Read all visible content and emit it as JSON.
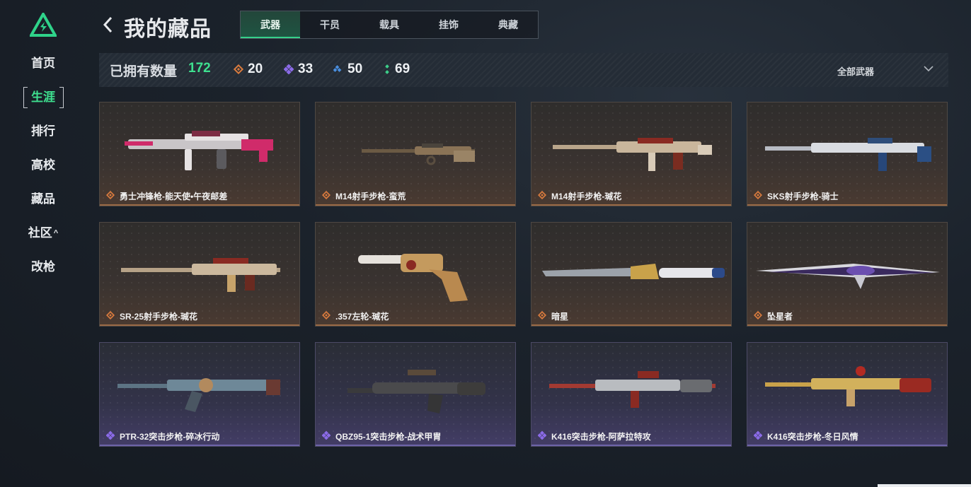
{
  "sidebar": {
    "items": [
      {
        "label": "首页"
      },
      {
        "label": "生涯"
      },
      {
        "label": "排行"
      },
      {
        "label": "高校"
      },
      {
        "label": "藏品"
      },
      {
        "label": "社区",
        "caret": "^"
      },
      {
        "label": "改枪"
      }
    ],
    "active_index": 1,
    "accent": "#3ee08f"
  },
  "header": {
    "title": "我的藏品",
    "tabs": [
      {
        "label": "武器"
      },
      {
        "label": "干员"
      },
      {
        "label": "载具"
      },
      {
        "label": "挂饰"
      },
      {
        "label": "典藏"
      }
    ],
    "active_tab": 0
  },
  "stats": {
    "owned_label": "已拥有数量",
    "owned_count": "172",
    "rarities": [
      {
        "icon": "orange-diamond-icon",
        "count": "20",
        "color": "#d97b3e"
      },
      {
        "icon": "purple-diamond-icon",
        "count": "33",
        "color": "#8b6be8"
      },
      {
        "icon": "blue-diamond-icon",
        "count": "50",
        "color": "#4a8fe0"
      },
      {
        "icon": "green-diamond-icon",
        "count": "69",
        "color": "#3ccf8a"
      }
    ],
    "filter_label": "全部武器"
  },
  "items": [
    {
      "name": "勇士冲锋枪-能天使•午夜邮差",
      "rarity": "orange"
    },
    {
      "name": "M14射手步枪-蛮荒",
      "rarity": "orange"
    },
    {
      "name": "M14射手步枪-瑊花",
      "rarity": "orange"
    },
    {
      "name": "SKS射手步枪-骑士",
      "rarity": "orange"
    },
    {
      "name": "SR-25射手步枪-瑊花",
      "rarity": "orange"
    },
    {
      "name": ".357左轮-瑊花",
      "rarity": "orange"
    },
    {
      "name": "暗星",
      "rarity": "orange"
    },
    {
      "name": "坠星者",
      "rarity": "orange"
    },
    {
      "name": "PTR-32突击步枪-碎冰行动",
      "rarity": "purple"
    },
    {
      "name": "QBZ95-1突击步枪-战术甲胄",
      "rarity": "purple"
    },
    {
      "name": "K416突击步枪-阿萨拉特攻",
      "rarity": "purple"
    },
    {
      "name": "K416突击步枪-冬日风情",
      "rarity": "purple"
    }
  ]
}
